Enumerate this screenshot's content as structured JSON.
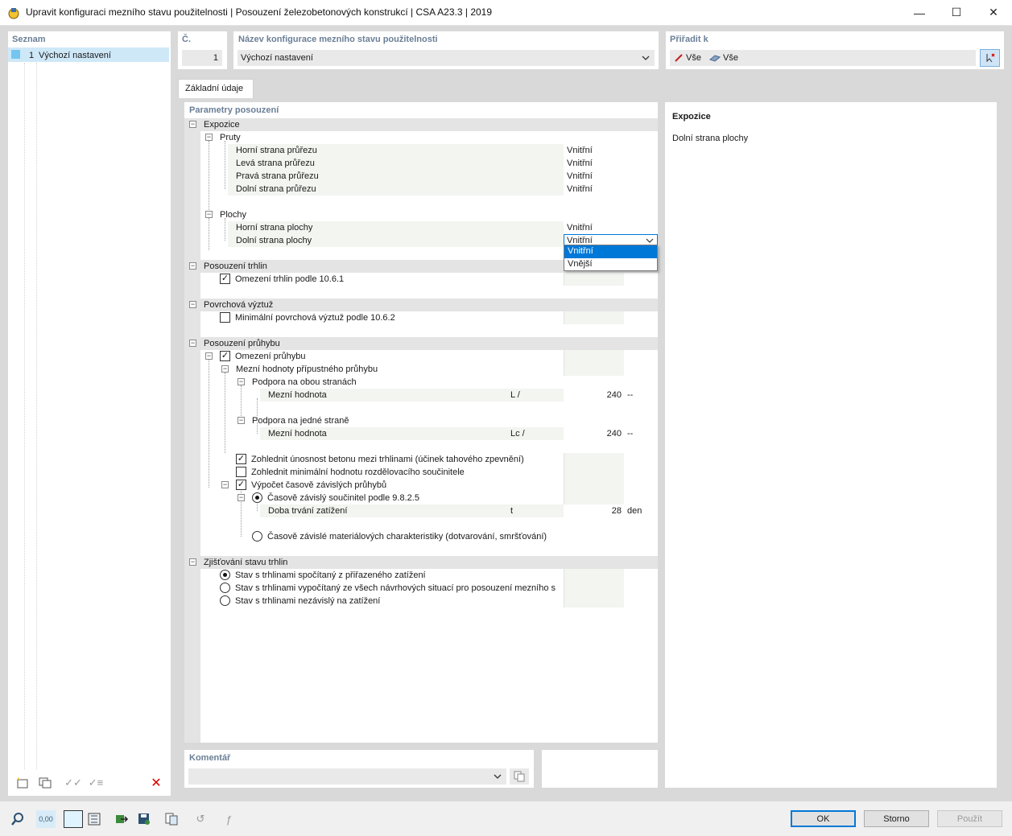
{
  "window": {
    "title": "Upravit konfiguraci mezního stavu použitelnosti | Posouzení železobetonových konstrukcí | CSA A23.3 | 2019",
    "minimize_glyph": "—",
    "maximize_glyph": "☐",
    "close_glyph": "✕"
  },
  "list": {
    "header": "Seznam",
    "items": [
      {
        "num": "1",
        "label": "Výchozí nastavení"
      }
    ]
  },
  "number": {
    "header": "Č.",
    "value": "1"
  },
  "config_name": {
    "header": "Název konfigurace mezního stavu použitelnosti",
    "value": "Výchozí nastavení"
  },
  "assign": {
    "header": "Přiřadit k",
    "all_members": "Vše",
    "all_surfaces": "Vše"
  },
  "tabs": [
    {
      "label": "Základní údaje"
    }
  ],
  "params": {
    "header": "Parametry posouzení",
    "exposure": {
      "label": "Expozice",
      "members": {
        "label": "Pruty",
        "rows": [
          {
            "label": "Horní strana průřezu",
            "value": "Vnitřní"
          },
          {
            "label": "Levá strana průřezu",
            "value": "Vnitřní"
          },
          {
            "label": "Pravá strana průřezu",
            "value": "Vnitřní"
          },
          {
            "label": "Dolní strana průřezu",
            "value": "Vnitřní"
          }
        ]
      },
      "surfaces": {
        "label": "Plochy",
        "rows": [
          {
            "label": "Horní strana plochy",
            "value": "Vnitřní"
          },
          {
            "label": "Dolní strana plochy",
            "value": "Vnitřní"
          }
        ]
      },
      "dropdown_options": [
        "Vnitřní",
        "Vnější"
      ]
    },
    "crack": {
      "label": "Posouzení trhlin",
      "limit": {
        "label": "Omezení trhlin podle 10.6.1",
        "checked": true
      }
    },
    "skin": {
      "label": "Povrchová výztuž",
      "min": {
        "label": "Minimální povrchová výztuž podle 10.6.2",
        "checked": false
      }
    },
    "deflection": {
      "label": "Posouzení průhybu",
      "limit": {
        "label": "Omezení průhybu",
        "checked": true
      },
      "limits": {
        "label": "Mezní hodnoty přípustného průhybu",
        "both": {
          "label": "Podpora na obou stranách",
          "row": {
            "label": "Mezní hodnota",
            "sym": "L /",
            "value": "240",
            "unit": "--"
          }
        },
        "one": {
          "label": "Podpora na jedné straně",
          "row": {
            "label": "Mezní hodnota",
            "sym": "Lc /",
            "value": "240",
            "unit": "--"
          }
        }
      },
      "tension_stiff": {
        "label": "Zohlednit únosnost betonu mezi trhlinami (účinek tahového zpevnění)",
        "checked": true
      },
      "min_dist": {
        "label": "Zohlednit minimální hodnotu rozdělovacího součinitele",
        "checked": false
      },
      "time_dep": {
        "label": "Výpočet časově závislých průhybů",
        "checked": true
      },
      "factor": {
        "label": "Časově závislý součinitel podle 9.8.2.5",
        "selected": true
      },
      "duration": {
        "label": "Doba trvání zatížení",
        "sym": "t",
        "value": "28",
        "unit": "den"
      },
      "material": {
        "label": "Časově závislé materiálových charakteristiky (dotvarování, smršťování)",
        "selected": false
      }
    },
    "crack_state": {
      "label": "Zjišťování stavu trhlin",
      "options": [
        {
          "label": "Stav s trhlinami spočítaný z přiřazeného zatížení",
          "selected": true
        },
        {
          "label": "Stav s trhlinami vypočítaný ze všech návrhových situací pro posouzení mezního s",
          "selected": false
        },
        {
          "label": "Stav s trhlinami nezávislý na zatížení",
          "selected": false
        }
      ]
    }
  },
  "info": {
    "title": "Expozice",
    "text": "Dolní strana plochy"
  },
  "comment": {
    "header": "Komentář",
    "value": ""
  },
  "buttons": {
    "ok": "OK",
    "cancel": "Storno",
    "apply": "Použít"
  },
  "colors": {
    "accent": "#0078d7",
    "header_text": "#6a7f96",
    "section_bg": "#e4e4e4",
    "selection": "#cfe8f8"
  }
}
